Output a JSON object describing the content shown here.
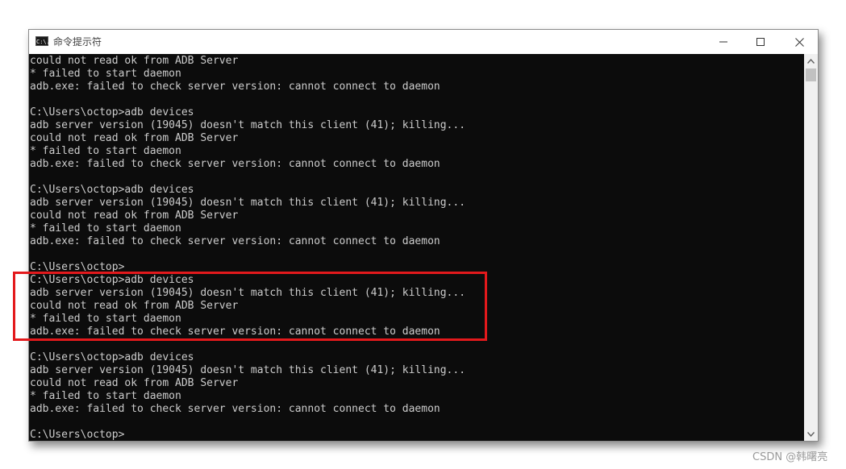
{
  "window": {
    "title": "命令提示符",
    "icon": "cmd-icon",
    "icon_label": "C:\\."
  },
  "console": {
    "lines": [
      "could not read ok from ADB Server",
      "* failed to start daemon",
      "adb.exe: failed to check server version: cannot connect to daemon",
      "",
      "C:\\Users\\octop>adb devices",
      "adb server version (19045) doesn't match this client (41); killing...",
      "could not read ok from ADB Server",
      "* failed to start daemon",
      "adb.exe: failed to check server version: cannot connect to daemon",
      "",
      "C:\\Users\\octop>adb devices",
      "adb server version (19045) doesn't match this client (41); killing...",
      "could not read ok from ADB Server",
      "* failed to start daemon",
      "adb.exe: failed to check server version: cannot connect to daemon",
      "",
      "C:\\Users\\octop>",
      "C:\\Users\\octop>adb devices",
      "adb server version (19045) doesn't match this client (41); killing...",
      "could not read ok from ADB Server",
      "* failed to start daemon",
      "adb.exe: failed to check server version: cannot connect to daemon",
      "",
      "C:\\Users\\octop>adb devices",
      "adb server version (19045) doesn't match this client (41); killing...",
      "could not read ok from ADB Server",
      "* failed to start daemon",
      "adb.exe: failed to check server version: cannot connect to daemon",
      "",
      "C:\\Users\\octop>"
    ]
  },
  "annotation": {
    "color": "#e3191c"
  },
  "watermark": {
    "text": "CSDN @韩曙亮"
  },
  "colors": {
    "console_bg": "#0c0c0c",
    "console_fg": "#cccccc",
    "titlebar_bg": "#ffffff",
    "scrollbar_bg": "#f0f0f0"
  }
}
